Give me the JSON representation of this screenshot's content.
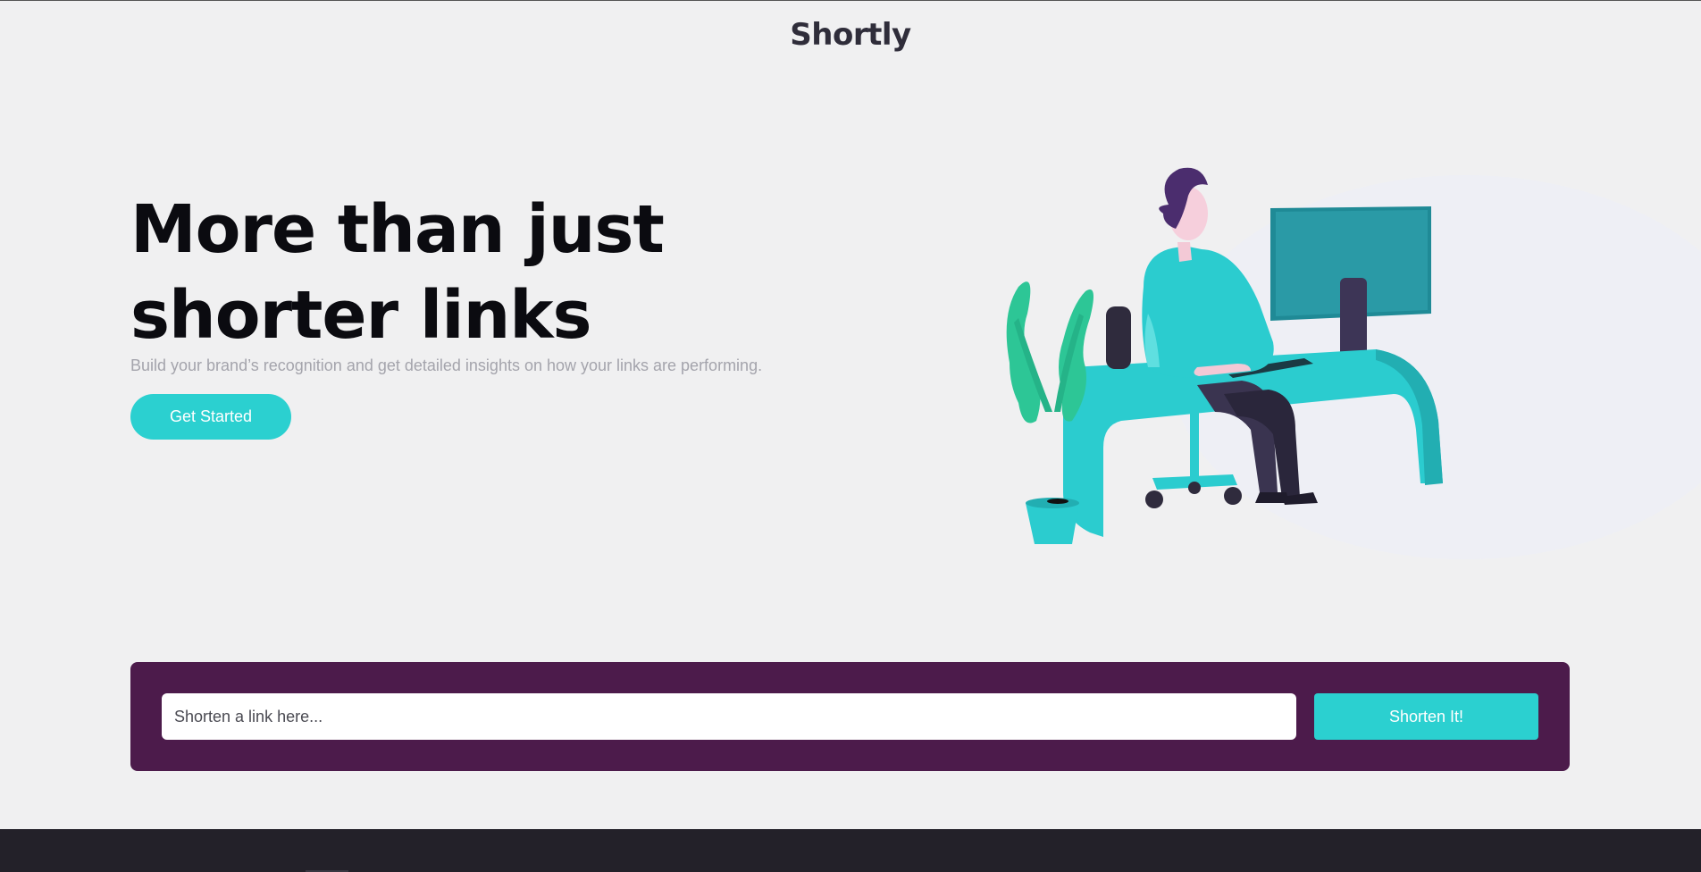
{
  "header": {
    "logo": "Shortly"
  },
  "hero": {
    "title": "More than just shorter links",
    "subtitle": "Build your brand’s recognition and get detailed insights on how your links are performing.",
    "cta_label": "Get Started",
    "illustration": "person-working-at-desk-illustration"
  },
  "shorten": {
    "placeholder": "Shorten a link here...",
    "value": "",
    "button_label": "Shorten It!"
  },
  "colors": {
    "accent": "#2bd0d0",
    "dark_violet": "#4c1b4b",
    "footer": "#232129",
    "background": "#f0f0f1"
  }
}
